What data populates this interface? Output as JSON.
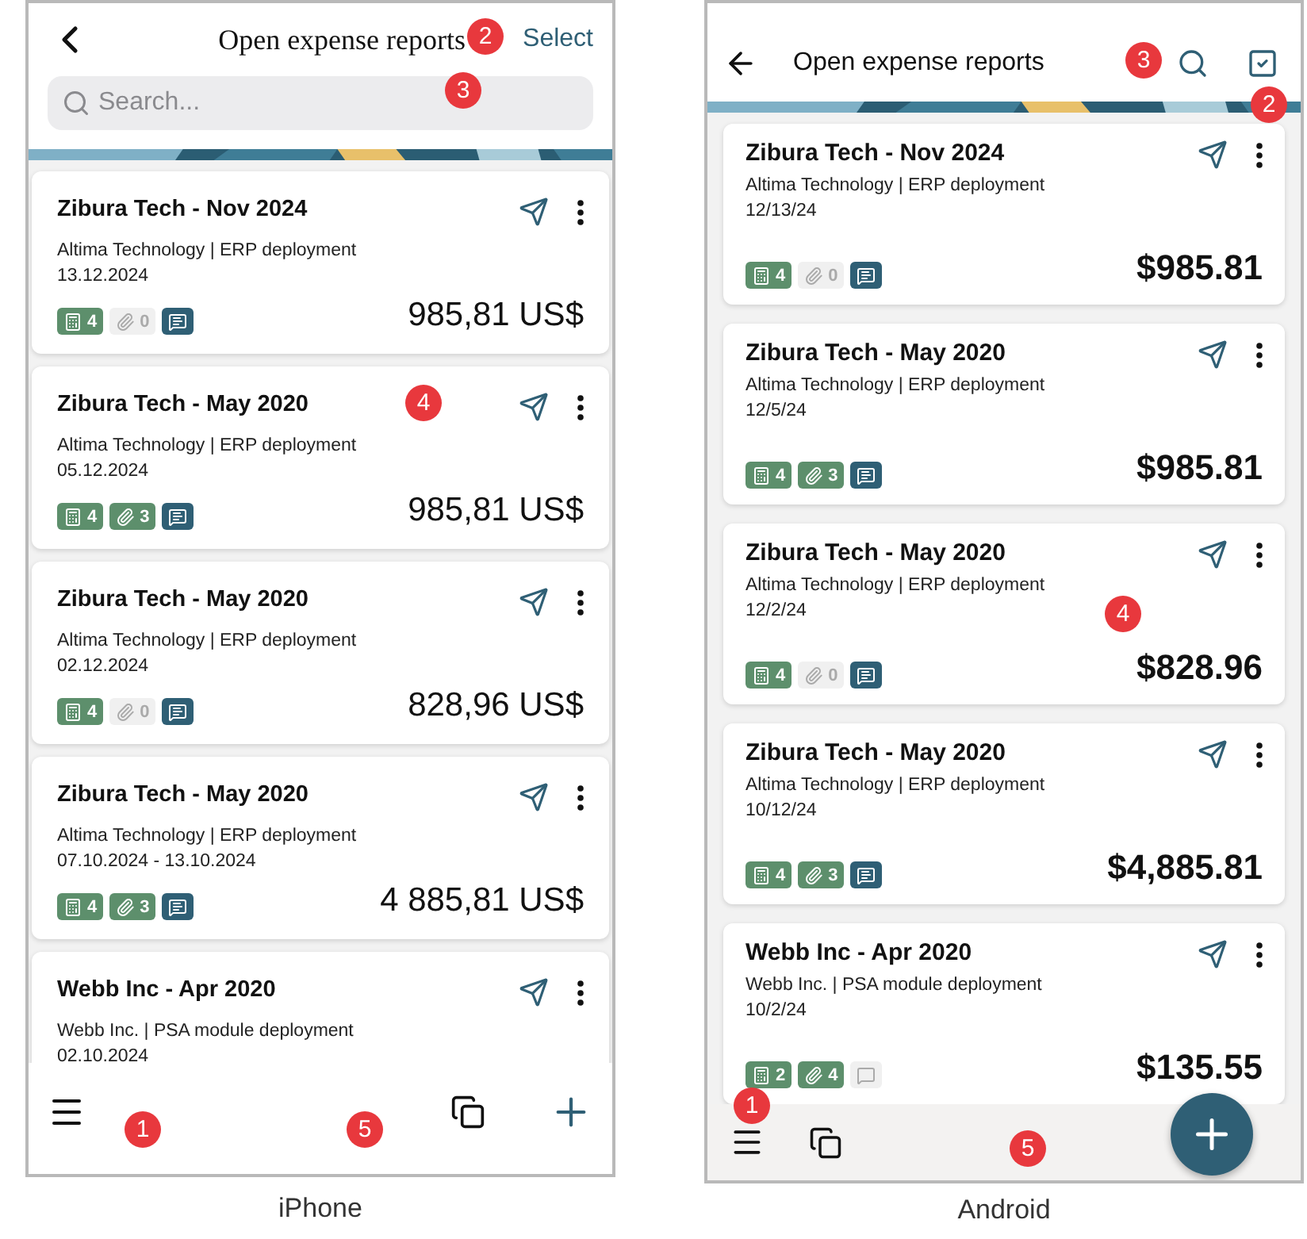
{
  "phones": [
    {
      "kind": "ios",
      "caption": "iPhone",
      "title": "Open expense reports",
      "select_label": "Select",
      "search": {
        "placeholder": "Search..."
      },
      "callouts": [
        "2",
        "3",
        "4",
        "1",
        "5"
      ],
      "reports": [
        {
          "title": "Zibura Tech - Nov 2024",
          "subtitle": "Altima Technology | ERP deployment",
          "date": "13.12.2024",
          "receipts": "4",
          "attachments": {
            "count": "0",
            "present": false
          },
          "comments": true,
          "amount": "985,81 US$"
        },
        {
          "title": "Zibura Tech - May 2020",
          "subtitle": "Altima Technology | ERP deployment",
          "date": "05.12.2024",
          "receipts": "4",
          "attachments": {
            "count": "3",
            "present": true
          },
          "comments": true,
          "amount": "985,81 US$"
        },
        {
          "title": "Zibura Tech - May 2020",
          "subtitle": "Altima Technology | ERP deployment",
          "date": "02.12.2024",
          "receipts": "4",
          "attachments": {
            "count": "0",
            "present": false
          },
          "comments": true,
          "amount": "828,96 US$"
        },
        {
          "title": "Zibura Tech - May 2020",
          "subtitle": "Altima Technology | ERP deployment",
          "date": "07.10.2024 - 13.10.2024",
          "receipts": "4",
          "attachments": {
            "count": "3",
            "present": true
          },
          "comments": true,
          "amount": "4 885,81 US$"
        },
        {
          "title": "Webb Inc - Apr 2020",
          "subtitle": "Webb Inc. | PSA module deployment",
          "date": "02.10.2024"
        }
      ]
    },
    {
      "kind": "android",
      "caption": "Android",
      "title": "Open expense reports",
      "callouts": [
        "3",
        "2",
        "4",
        "1",
        "5"
      ],
      "reports": [
        {
          "title": "Zibura Tech - Nov 2024",
          "subtitle": "Altima Technology | ERP deployment",
          "date": "12/13/24",
          "receipts": "4",
          "attachments": {
            "count": "0",
            "present": false
          },
          "comments": true,
          "amount": "$985.81"
        },
        {
          "title": "Zibura Tech - May 2020",
          "subtitle": "Altima Technology | ERP deployment",
          "date": "12/5/24",
          "receipts": "4",
          "attachments": {
            "count": "3",
            "present": true
          },
          "comments": true,
          "amount": "$985.81"
        },
        {
          "title": "Zibura Tech - May 2020",
          "subtitle": "Altima Technology | ERP deployment",
          "date": "12/2/24",
          "receipts": "4",
          "attachments": {
            "count": "0",
            "present": false
          },
          "comments": true,
          "amount": "$828.96"
        },
        {
          "title": "Zibura Tech - May 2020",
          "subtitle": "Altima Technology | ERP deployment",
          "date": "10/12/24",
          "receipts": "4",
          "attachments": {
            "count": "3",
            "present": true
          },
          "comments": true,
          "amount": "$4,885.81"
        },
        {
          "title": "Webb Inc - Apr 2020",
          "subtitle": "Webb Inc. | PSA module deployment",
          "date": "10/2/24",
          "receipts": "2",
          "attachments": {
            "count": "4",
            "present": true
          },
          "comments": false,
          "amount": "$135.55"
        }
      ]
    }
  ]
}
